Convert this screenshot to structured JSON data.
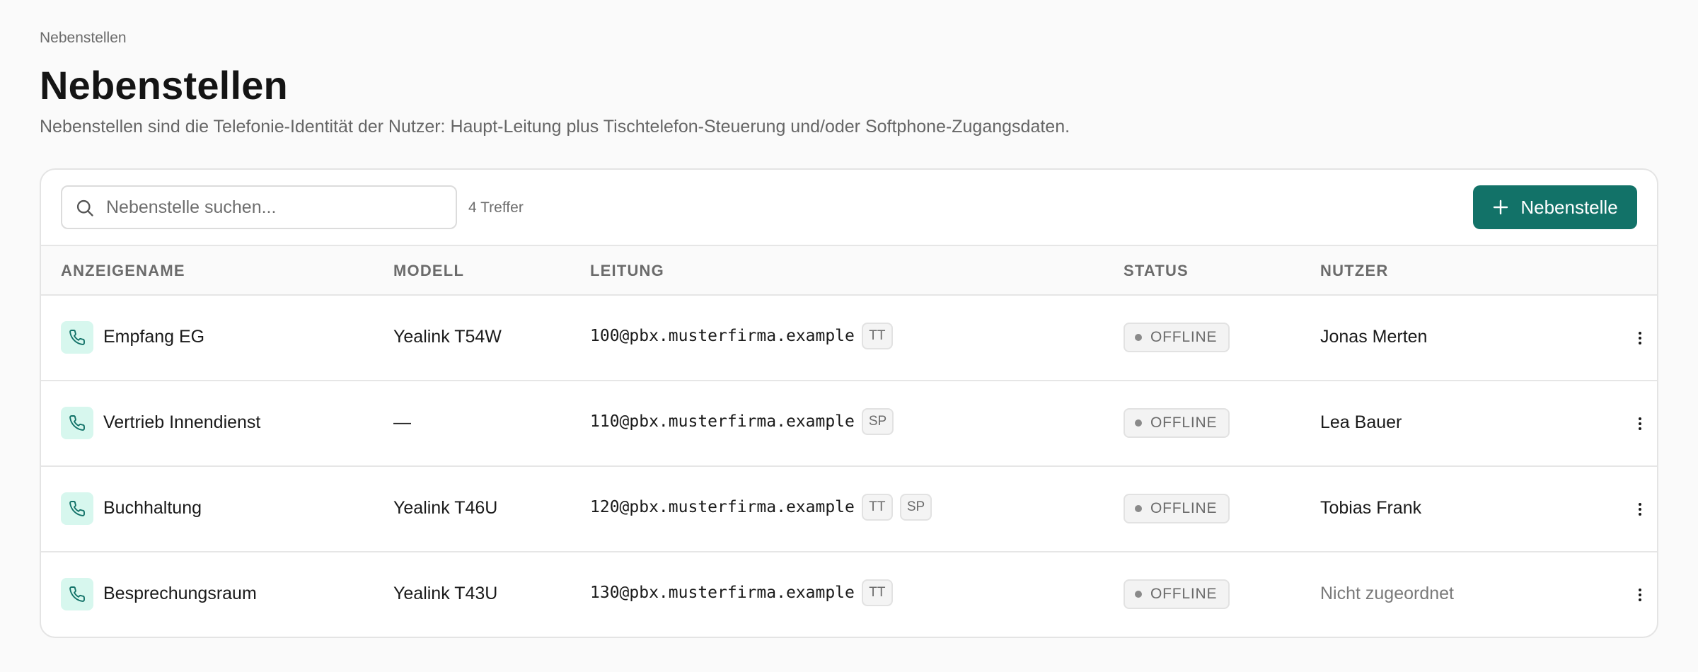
{
  "breadcrumb": "Nebenstellen",
  "page": {
    "title": "Nebenstellen",
    "description": "Nebenstellen sind die Telefonie-Identität der Nutzer: Haupt-Leitung plus Tischtelefon-Steuerung und/oder Softphone-Zugangsdaten."
  },
  "toolbar": {
    "search_placeholder": "Nebenstelle suchen...",
    "search_value": "",
    "result_count": "4 Treffer",
    "add_label": "Nebenstelle"
  },
  "table": {
    "columns": {
      "name": "ANZEIGENAME",
      "model": "MODELL",
      "line": "LEITUNG",
      "status": "STATUS",
      "user": "NUTZER"
    },
    "rows": [
      {
        "name": "Empfang EG",
        "model": "Yealink T54W",
        "line": "100@pbx.musterfirma.example",
        "tags": [
          "TT"
        ],
        "status": "OFFLINE",
        "user": "Jonas Merten",
        "user_assigned": true
      },
      {
        "name": "Vertrieb Innendienst",
        "model": "—",
        "line": "110@pbx.musterfirma.example",
        "tags": [
          "SP"
        ],
        "status": "OFFLINE",
        "user": "Lea Bauer",
        "user_assigned": true
      },
      {
        "name": "Buchhaltung",
        "model": "Yealink T46U",
        "line": "120@pbx.musterfirma.example",
        "tags": [
          "TT",
          "SP"
        ],
        "status": "OFFLINE",
        "user": "Tobias Frank",
        "user_assigned": true
      },
      {
        "name": "Besprechungsraum",
        "model": "Yealink T43U",
        "line": "130@pbx.musterfirma.example",
        "tags": [
          "TT"
        ],
        "status": "OFFLINE",
        "user": "Nicht zugeordnet",
        "user_assigned": false
      }
    ]
  },
  "icons": {
    "search": "search-icon",
    "add": "plus-icon",
    "row": "phone-icon",
    "menu": "more-vertical-icon"
  },
  "colors": {
    "accent": "#127268",
    "phone_badge_bg": "#d7f7ee",
    "phone_icon": "#127268",
    "status_dot": "#8a8a8a"
  }
}
